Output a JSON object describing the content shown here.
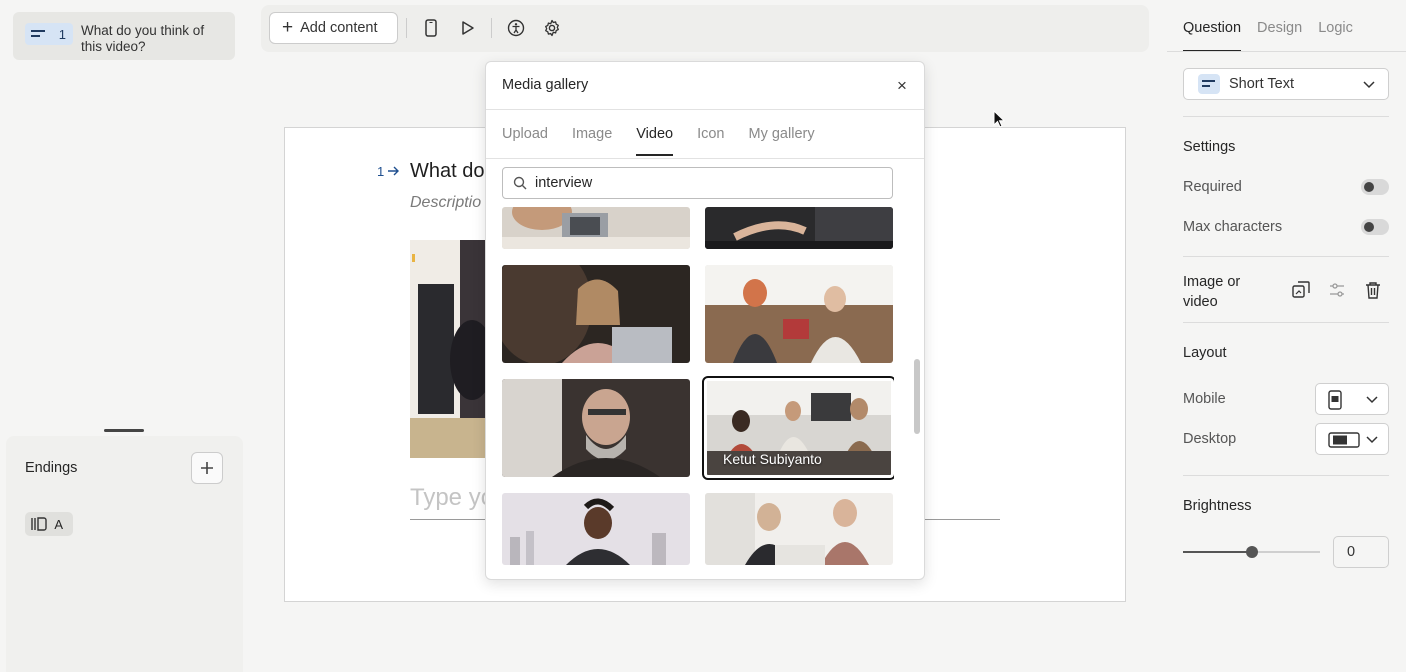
{
  "left_panel": {
    "question_item": {
      "number": "1",
      "title": "What do you think of this video?"
    },
    "endings": {
      "label": "Endings",
      "ending_badge_letter": "A"
    }
  },
  "toolbar": {
    "add_content_label": "Add content"
  },
  "canvas": {
    "question_number": "1",
    "question_text": "What do",
    "description_placeholder": "Descriptio",
    "answer_placeholder": "Type yo"
  },
  "media_gallery": {
    "title": "Media gallery",
    "close_glyph": "×",
    "tabs": [
      {
        "label": "Upload",
        "active": false
      },
      {
        "label": "Image",
        "active": false
      },
      {
        "label": "Video",
        "active": true
      },
      {
        "label": "Icon",
        "active": false
      },
      {
        "label": "My gallery",
        "active": false
      }
    ],
    "search_value": "interview",
    "selected_thumbnail_label": "Ketut Subiyanto"
  },
  "right_panel": {
    "tabs": [
      {
        "label": "Question",
        "active": true
      },
      {
        "label": "Design",
        "active": false
      },
      {
        "label": "Logic",
        "active": false
      }
    ],
    "question_type": "Short Text",
    "settings_heading": "Settings",
    "required_label": "Required",
    "required_on": false,
    "max_characters_label": "Max characters",
    "max_characters_on": false,
    "image_or_video_label": "Image or video",
    "layout_heading": "Layout",
    "mobile_label": "Mobile",
    "desktop_label": "Desktop",
    "brightness_heading": "Brightness",
    "brightness_value": "0",
    "brightness_slider_fraction": 0.5
  },
  "colors": {
    "accent_badge": "#d6e4f5",
    "question_arrow": "#1f4f8f",
    "panel_bg": "#f5f5f4"
  }
}
